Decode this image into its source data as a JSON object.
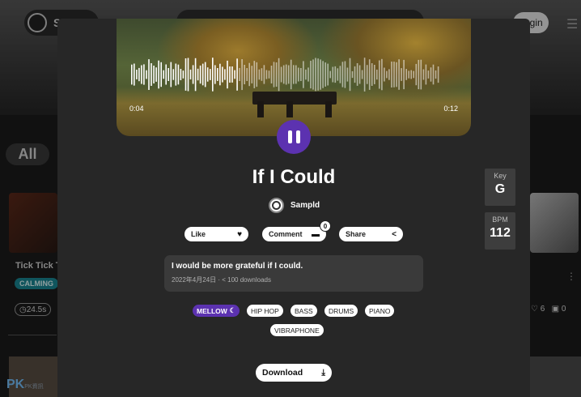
{
  "background": {
    "logo_text": "So",
    "login_label": "Login",
    "filter_all": "All",
    "card_title": "Tick Tick Ti",
    "card_tag": "CALMING",
    "card_duration": "24.5s",
    "card_likes": "6",
    "card_comments": "0",
    "watermark": "PK",
    "watermark_sub": "PK資訊"
  },
  "player": {
    "time_current": "0:04",
    "time_total": "0:12",
    "state": "playing"
  },
  "track": {
    "title": "If I Could",
    "artist": "Sampld",
    "description": "I would be more grateful if I could.",
    "meta": "2022年4月24日 · < 100 downloads",
    "key_label": "Key",
    "key_value": "G",
    "bpm_label": "BPM",
    "bpm_value": "112"
  },
  "actions": {
    "like_label": "Like",
    "comment_label": "Comment",
    "comment_count": "0",
    "share_label": "Share",
    "download_label": "Download"
  },
  "tags": [
    "MELLOW",
    "HIP HOP",
    "BASS",
    "DRUMS",
    "PIANO",
    "VIBRAPHONE"
  ],
  "colors": {
    "accent": "#5c32b0",
    "modal_bg": "#272727",
    "tag_calming": "#1a8a96"
  }
}
